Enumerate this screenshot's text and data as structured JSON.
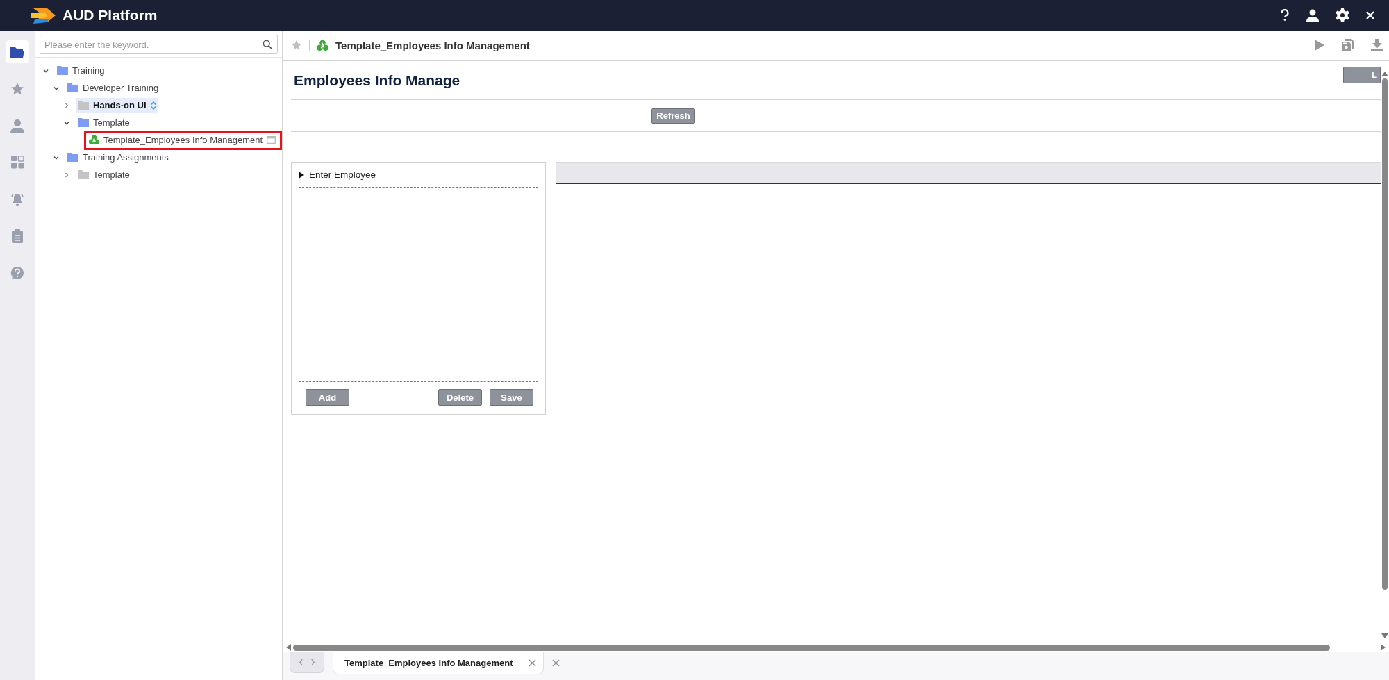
{
  "app": {
    "title": "AUD Platform"
  },
  "rail": [
    {
      "kind": "folder",
      "selected": true
    },
    {
      "kind": "star",
      "selected": false
    },
    {
      "kind": "user",
      "selected": false
    },
    {
      "kind": "grid",
      "selected": false
    },
    {
      "kind": "bell",
      "selected": false
    },
    {
      "kind": "clipboard",
      "selected": false
    },
    {
      "kind": "help",
      "selected": false
    }
  ],
  "search": {
    "placeholder": "Please enter the keyword."
  },
  "tree": [
    {
      "kind": "folder",
      "label": "Training",
      "expanded": true,
      "selected": false,
      "children": [
        {
          "kind": "folder",
          "label": "Developer Training",
          "expanded": true,
          "selected": false,
          "children": [
            {
              "kind": "folder",
              "label": "Hands-on UI",
              "expanded": false,
              "selected": true,
              "sync": true
            },
            {
              "kind": "folder",
              "label": "Template",
              "expanded": true,
              "selected": false,
              "children": [
                {
                  "kind": "app",
                  "label": "Template_Employees Info Management",
                  "selected": false,
                  "highlighted": true
                }
              ]
            }
          ]
        },
        {
          "kind": "folder",
          "label": "Training Assignments",
          "expanded": true,
          "selected": false,
          "children": [
            {
              "kind": "folder",
              "label": "Template",
              "expanded": false,
              "selected": false
            }
          ]
        }
      ]
    }
  ],
  "toolbar": {
    "favorite": false,
    "title": "Template_Employees Info Management"
  },
  "page": {
    "heading": "Employees Info Manage",
    "corner_button": "L",
    "refresh_button": "Refresh",
    "form": {
      "title": "Enter Employee",
      "buttons": [
        "Add",
        "Delete",
        "Save"
      ]
    }
  },
  "tabs": [
    {
      "label": "Template_Employees Info Management",
      "selected": true
    }
  ]
}
